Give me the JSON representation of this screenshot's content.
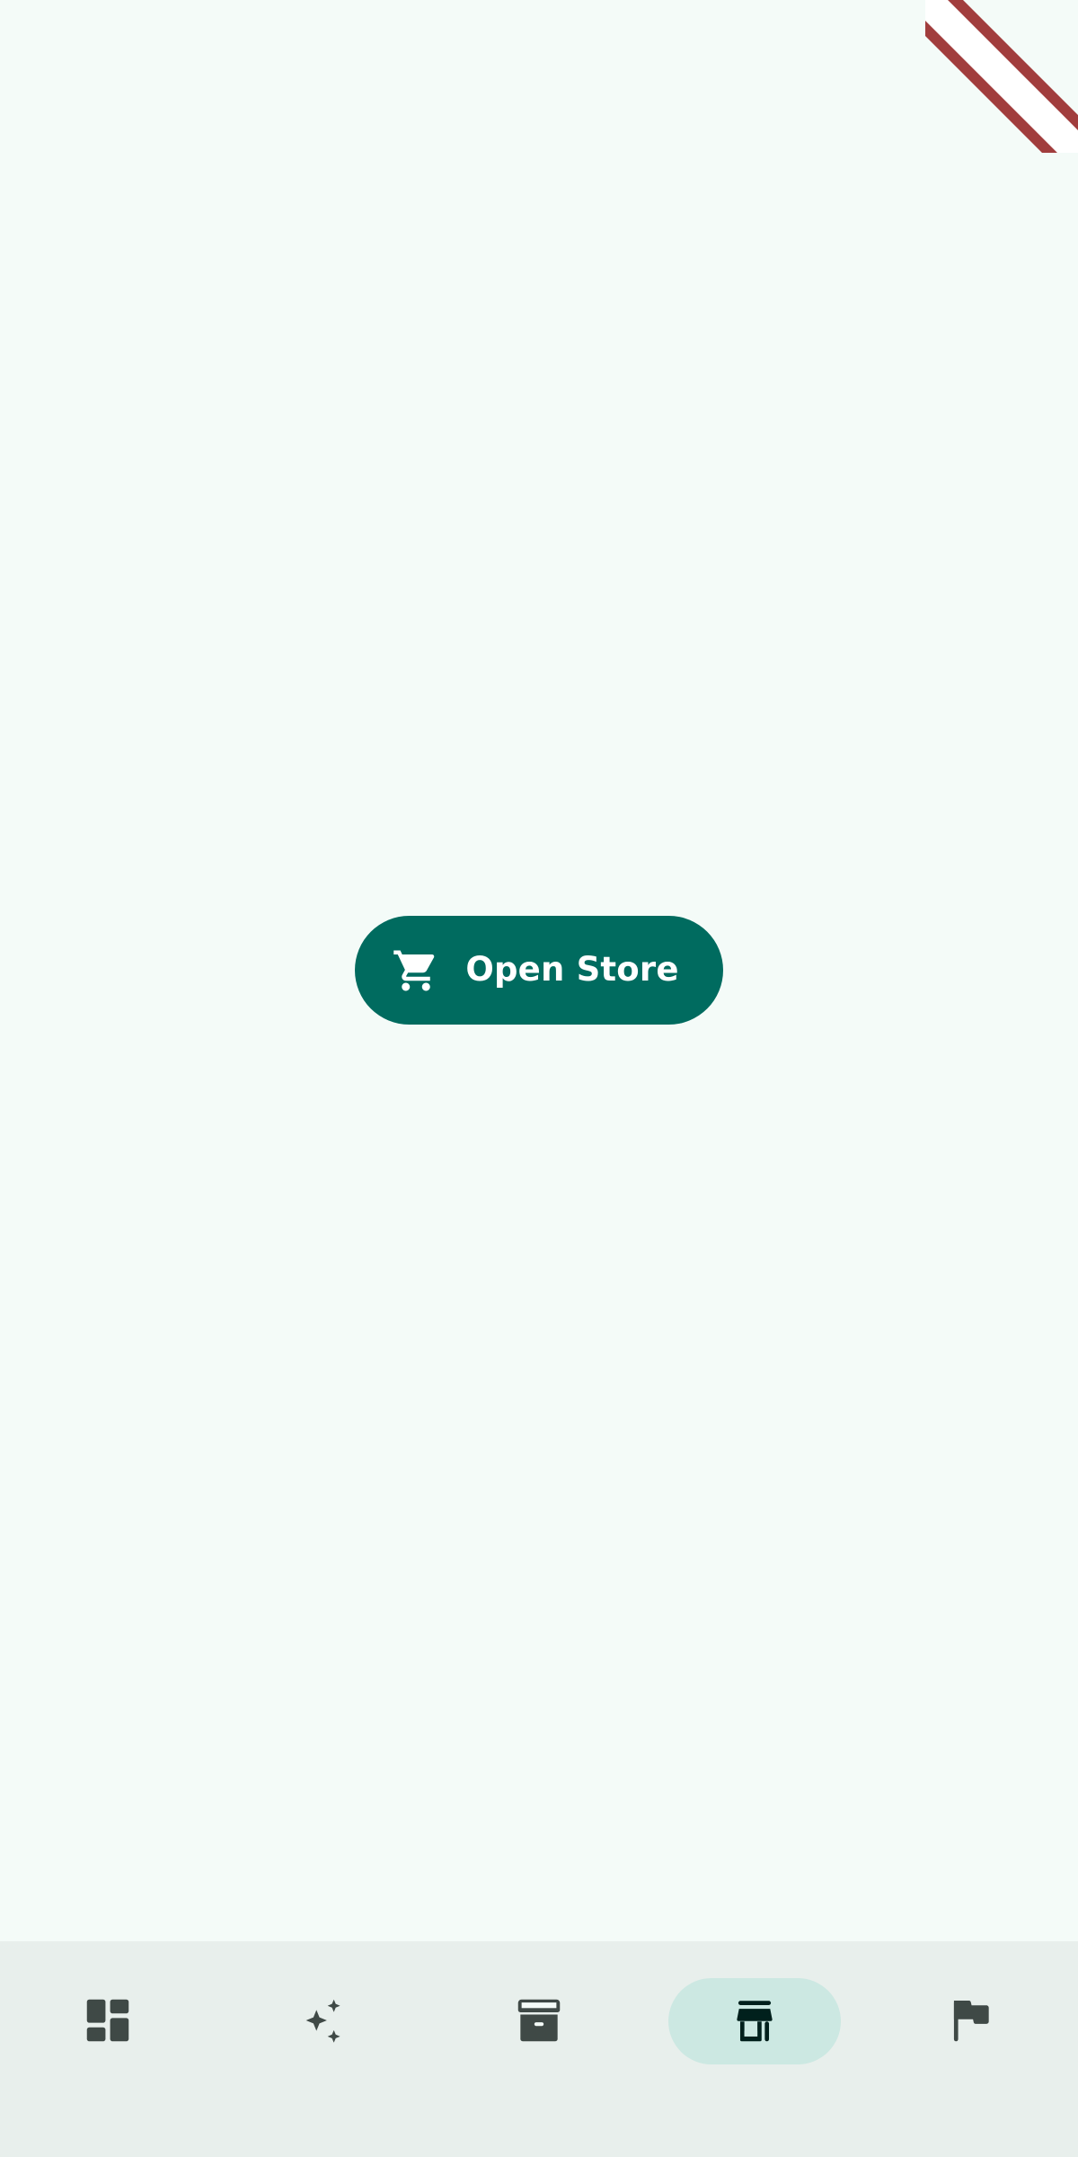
{
  "main": {
    "open_store_button": {
      "label": "Open Store",
      "icon": "shopping-cart-icon"
    }
  },
  "debug_banner": {
    "label": ""
  },
  "bottom_nav": {
    "selected_index": 3,
    "items": [
      {
        "icon": "dashboard-icon",
        "selected": false
      },
      {
        "icon": "sparkles-icon",
        "selected": false
      },
      {
        "icon": "archive-icon",
        "selected": false
      },
      {
        "icon": "storefront-icon",
        "selected": true
      },
      {
        "icon": "flag-icon",
        "selected": false
      }
    ]
  },
  "colors": {
    "background": "#F4FBF8",
    "primary": "#006B5F",
    "on_primary": "#FFFFFF",
    "nav_background": "#E8EFEC",
    "nav_indicator": "#CCE8E2",
    "nav_icon": "#3F4946",
    "nav_icon_selected": "#00201C",
    "debug_banner": "#A13D3D"
  }
}
